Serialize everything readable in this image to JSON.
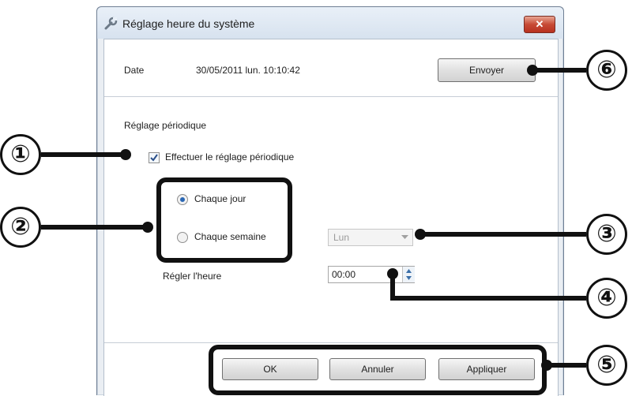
{
  "dialog": {
    "title": "Réglage heure du système",
    "close_symbol": "✕"
  },
  "date_row": {
    "label": "Date",
    "value": "30/05/2011 lun. 10:10:42",
    "send_button": "Envoyer"
  },
  "periodic": {
    "section_label": "Réglage périodique",
    "checkbox_label": "Effectuer le réglage périodique",
    "checkbox_checked": true,
    "radio_daily": "Chaque jour",
    "radio_weekly": "Chaque semaine",
    "selected_radio": "Chaque jour",
    "weekday_value": "Lun",
    "time_label": "Régler l'heure",
    "time_value": "00:00"
  },
  "footer": {
    "ok_button": "OK",
    "cancel_button": "Annuler",
    "apply_button": "Appliquer"
  },
  "callouts": [
    "①",
    "②",
    "③",
    "④",
    "⑤",
    "⑥"
  ],
  "icons": {
    "title_icon": "wrench-icon"
  }
}
